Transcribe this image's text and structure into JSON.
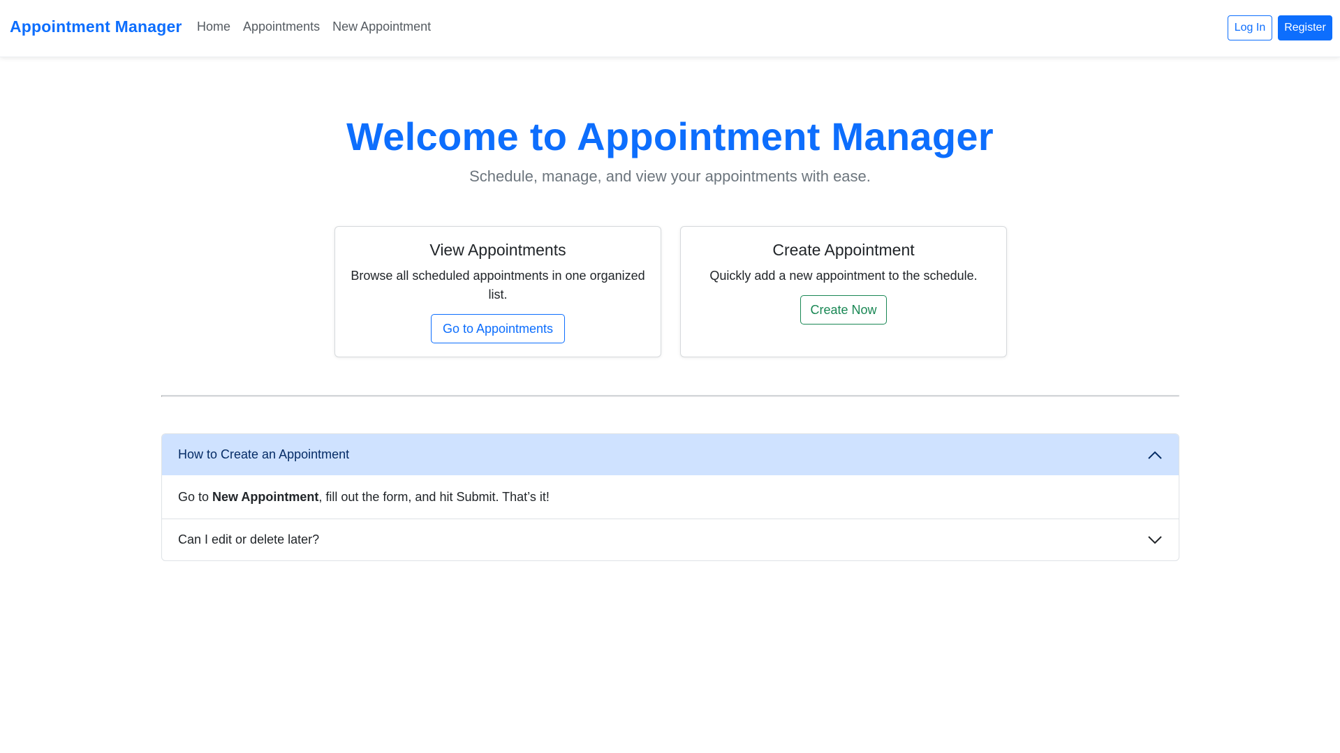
{
  "navbar": {
    "brand": "Appointment Manager",
    "links": [
      "Home",
      "Appointments",
      "New Appointment"
    ],
    "login_label": "Log In",
    "register_label": "Register"
  },
  "hero": {
    "title": "Welcome to Appointment Manager",
    "subtitle": "Schedule, manage, and view your appointments with ease."
  },
  "cards": [
    {
      "title": "View Appointments",
      "text": "Browse all scheduled appointments in one organized list.",
      "button": "Go to Appointments"
    },
    {
      "title": "Create Appointment",
      "text": "Quickly add a new appointment to the schedule.",
      "button": "Create Now"
    }
  ],
  "accordion": {
    "items": [
      {
        "question": "How to Create an Appointment",
        "expanded": true,
        "answer_prefix": "Go to ",
        "answer_bold": "New Appointment",
        "answer_suffix": ", fill out the form, and hit Submit. That’s it!"
      },
      {
        "question": "Can I edit or delete later?",
        "expanded": false
      }
    ]
  },
  "colors": {
    "primary": "#0d6efd",
    "success": "#198754",
    "accordion_active_bg": "#cfe2ff"
  },
  "icons": {
    "expanded": "chevron-up-icon",
    "collapsed": "chevron-down-icon"
  }
}
